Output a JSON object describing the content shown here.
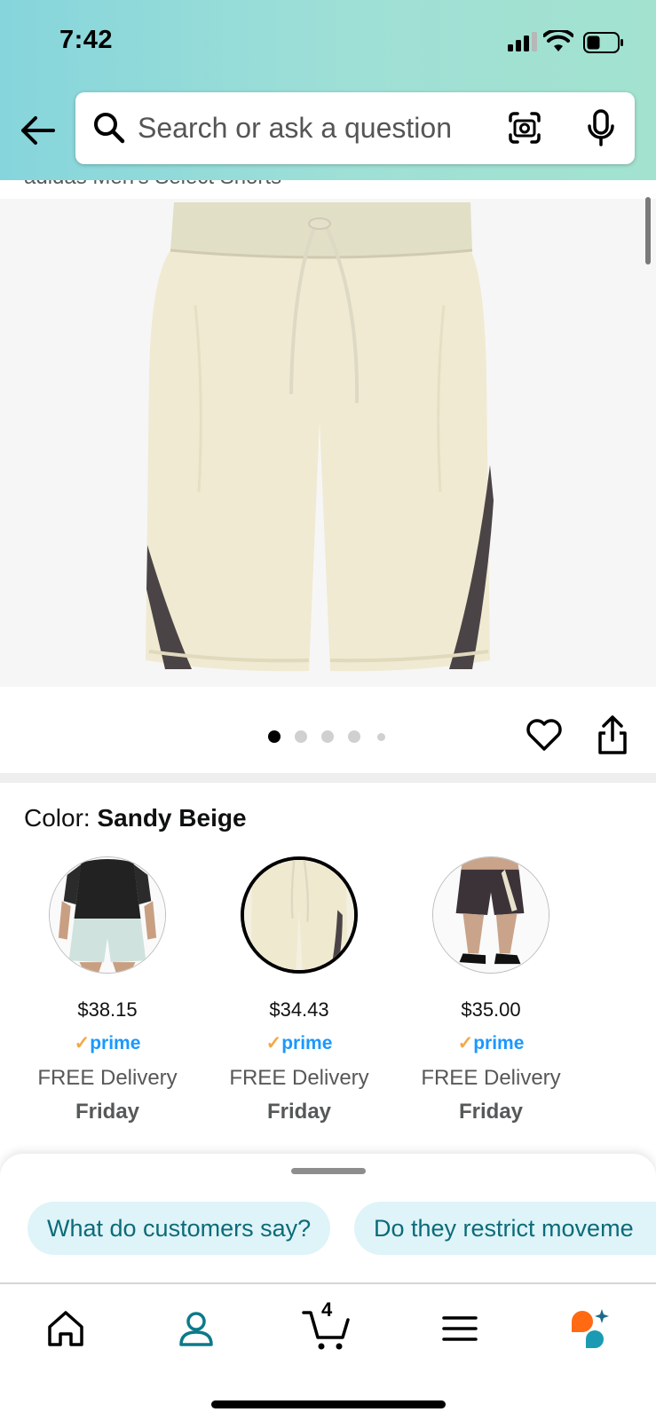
{
  "status_bar": {
    "time": "7:42"
  },
  "search": {
    "placeholder": "Search or ask a question"
  },
  "product": {
    "title": "adidas Men's Select Shorts",
    "image_count": 5,
    "selected_image": 1
  },
  "color": {
    "label": "Color: ",
    "value": "Sandy Beige"
  },
  "swatches": [
    {
      "price": "$38.15",
      "prime": "prime",
      "delivery": "FREE Delivery",
      "day": "Friday",
      "selected": false
    },
    {
      "price": "$34.43",
      "prime": "prime",
      "delivery": "FREE Delivery",
      "day": "Friday",
      "selected": true
    },
    {
      "price": "$35.00",
      "prime": "prime",
      "delivery": "FREE Delivery",
      "day": "Friday",
      "selected": false
    }
  ],
  "suggestions": [
    "What do customers say?",
    "Do they restrict moveme"
  ],
  "tabbar": {
    "cart_count": "4"
  },
  "colors": {
    "header_gradient_start": "#86d5dc",
    "header_gradient_end": "#a3e2cf",
    "prime_blue": "#1a98ff",
    "prime_check": "#f3a847",
    "chip_bg": "#dff4f8",
    "chip_text": "#0b6b7a",
    "account_tab": "#0b7a8a"
  }
}
